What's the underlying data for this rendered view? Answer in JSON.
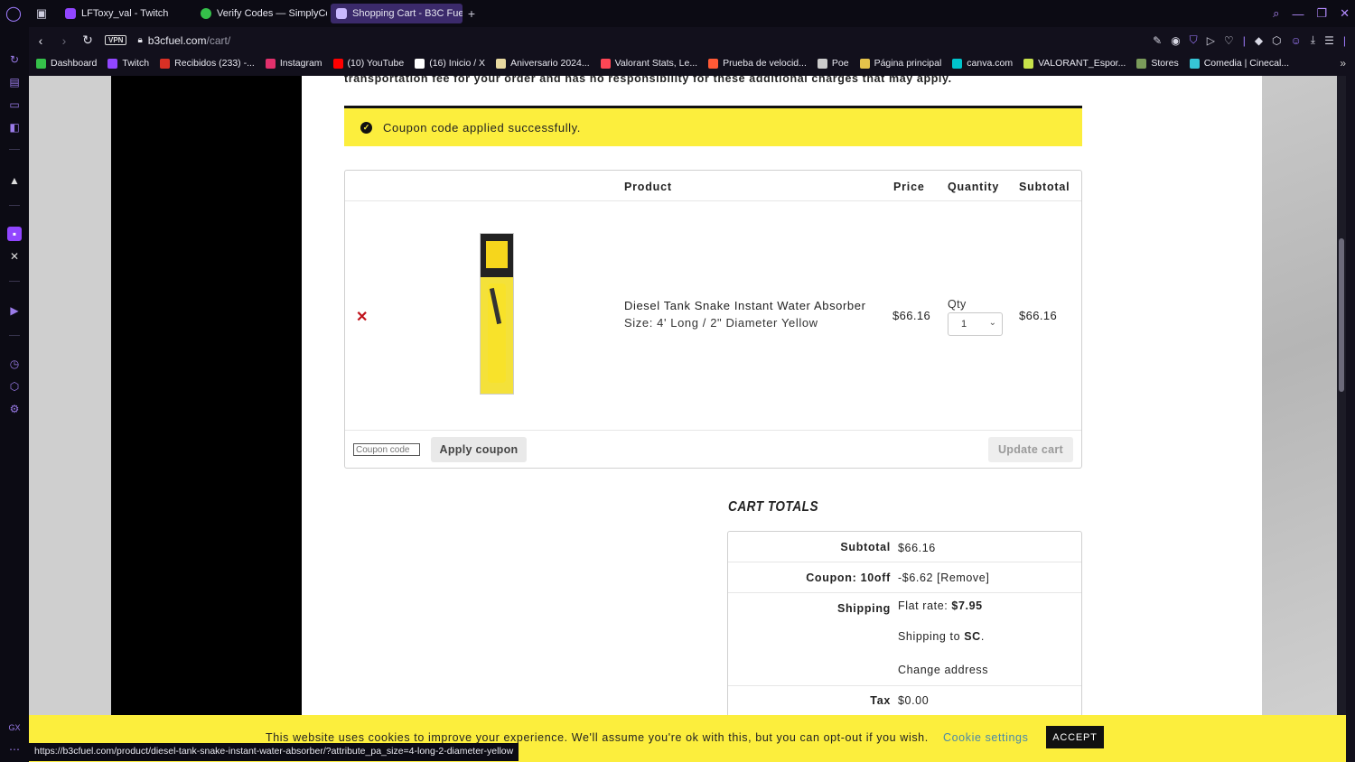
{
  "browser": {
    "tabs": [
      {
        "title": "LFToxy_val - Twitch",
        "color": "#9146ff"
      },
      {
        "title": "Verify Codes — SimplyCo",
        "color": "#35c04a"
      },
      {
        "title": "Shopping Cart - B3C Fue",
        "color": "#c9b8ff"
      }
    ],
    "url_host": "b3cfuel.com",
    "url_path": "/cart/",
    "vpn_label": "VPN",
    "bookmarks": [
      {
        "label": "Dashboard",
        "color": "#35c04a"
      },
      {
        "label": "Twitch",
        "color": "#9146ff"
      },
      {
        "label": "Recibidos (233) -...",
        "color": "#d93025"
      },
      {
        "label": "Instagram",
        "color": "#e1306c"
      },
      {
        "label": "(10) YouTube",
        "color": "#ff0000"
      },
      {
        "label": "(16) Inicio / X",
        "color": "#ffffff"
      },
      {
        "label": "Aniversario 2024...",
        "color": "#e8d9a0"
      },
      {
        "label": "Valorant Stats, Le...",
        "color": "#ff4655"
      },
      {
        "label": "Prueba de velocid...",
        "color": "#ff5a36"
      },
      {
        "label": "Poe",
        "color": "#cccccc"
      },
      {
        "label": "Página principal",
        "color": "#e5c34b"
      },
      {
        "label": "canva.com",
        "color": "#00c4cc"
      },
      {
        "label": "VALORANT_Espor...",
        "color": "#c7e24a"
      },
      {
        "label": "Stores",
        "color": "#7a9b5a"
      },
      {
        "label": "Comedia | Cinecal...",
        "color": "#36c5d6"
      }
    ],
    "status_url": "https://b3cfuel.com/product/diesel-tank-snake-instant-water-absorber/?attribute_pa_size=4-long-2-diameter-yellow"
  },
  "page": {
    "transport_note": "transportation fee for your order and has no responsibility for these additional charges that may apply.",
    "notice": "Coupon code applied successfully.",
    "table_headers": {
      "product": "Product",
      "price": "Price",
      "quantity": "Quantity",
      "subtotal": "Subtotal"
    },
    "item": {
      "name": "Diesel Tank Snake Instant Water Absorber",
      "size": "Size: 4' Long / 2\" Diameter Yellow",
      "price": "$66.16",
      "qty_label": "Qty",
      "qty": "1",
      "subtotal": "$66.16"
    },
    "coupon_placeholder": "Coupon code",
    "apply_coupon": "Apply coupon",
    "update_cart": "Update cart",
    "totals": {
      "heading": "CART TOTALS",
      "subtotal_label": "Subtotal",
      "subtotal_value": "$66.16",
      "coupon_label": "Coupon: 10off",
      "coupon_value": "-$6.62 [Remove]",
      "shipping_label": "Shipping",
      "shipping_rate_prefix": "Flat rate: ",
      "shipping_rate": "$7.95",
      "shipping_to_prefix": "Shipping to ",
      "shipping_to": "SC",
      "change_address": "Change address",
      "tax_label": "Tax",
      "tax_value": "$0.00"
    },
    "cookie": {
      "text": "This website uses cookies to improve your experience. We'll assume you're ok with this, but you can opt-out if you wish.",
      "settings": "Cookie settings",
      "accept": "ACCEPT"
    }
  }
}
